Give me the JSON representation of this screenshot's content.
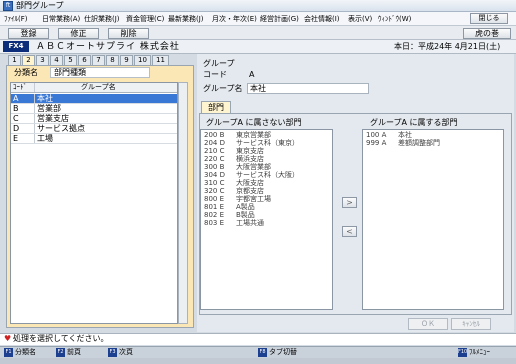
{
  "window": {
    "title": "部門グループ",
    "close_label": "閉じる"
  },
  "menu": [
    "ﾌｧｲﾙ(F)",
    "日常業務(A)",
    "仕訳業務(J)",
    "資金管理(C)",
    "最新業務(J)",
    "月次・年次(E)",
    "経営計画(G)",
    "会社情報(I)",
    "表示(V)",
    "ｳｨﾝﾄﾞｳ(W)"
  ],
  "toolbar": {
    "register": "登録",
    "modify": "修正",
    "delete": "削除",
    "bookmark": "虎の巻"
  },
  "info": {
    "badge": "FX4",
    "company": "ＡＢＣオートサプライ 株式会社",
    "today": "本日：平成24年 4月21日(土)"
  },
  "number_tabs": [
    "1",
    "2",
    "3",
    "4",
    "5",
    "6",
    "7",
    "8",
    "9",
    "10",
    "11"
  ],
  "left": {
    "category_label": "分類名",
    "category_value": "部門種類",
    "columns": {
      "code": "ｺｰﾄﾞ",
      "name": "グループ名"
    },
    "rows": [
      {
        "code": "A",
        "name": "本社"
      },
      {
        "code": "B",
        "name": "営業部"
      },
      {
        "code": "C",
        "name": "営業支店"
      },
      {
        "code": "D",
        "name": "サービス拠点"
      },
      {
        "code": "E",
        "name": "工場"
      }
    ]
  },
  "right": {
    "group_heading": "グループ",
    "code_label": "コード",
    "code_value": "A",
    "group_name_label": "グループ名",
    "group_name_value": "本社",
    "dept_tab": "部門",
    "not_in_title": "グループA に属さない部門",
    "in_title": "グループA に属する部門",
    "not_in_list": [
      {
        "c": "200 B",
        "n": "東京営業部"
      },
      {
        "c": "204 D",
        "n": "サービス科（東京）"
      },
      {
        "c": "210 C",
        "n": "東京支店"
      },
      {
        "c": "220 C",
        "n": "横浜支店"
      },
      {
        "c": "300 B",
        "n": "大阪営業部"
      },
      {
        "c": "304 D",
        "n": "サービス科（大阪）"
      },
      {
        "c": "310 C",
        "n": "大阪支店"
      },
      {
        "c": "320 C",
        "n": "京都支店"
      },
      {
        "c": "800 E",
        "n": "宇都宮工場"
      },
      {
        "c": "801 E",
        "n": "A製品"
      },
      {
        "c": "802 E",
        "n": "B製品"
      },
      {
        "c": "803 E",
        "n": "工場共通"
      }
    ],
    "in_list": [
      {
        "c": "100 A",
        "n": "本社"
      },
      {
        "c": "999 A",
        "n": "差額調整部門"
      }
    ],
    "add_label": ">",
    "remove_label": "<",
    "ok_label": "ＯＫ",
    "cancel_label": "ｷｬﾝｾﾙ"
  },
  "status": {
    "text": "処理を選択してください。"
  },
  "fkeys": [
    {
      "key": "F1",
      "label": "分類名"
    },
    {
      "key": "F2",
      "label": "前頁"
    },
    {
      "key": "F3",
      "label": "次頁"
    },
    {
      "key": "F8",
      "label": "タブ切替"
    },
    {
      "key": "F10",
      "label": "ﾌﾙﾒﾆｭｰ"
    }
  ]
}
